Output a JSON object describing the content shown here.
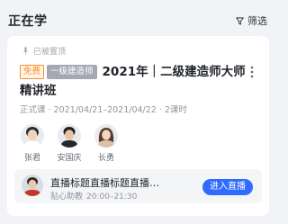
{
  "header": {
    "title": "正在学",
    "filter_label": "筛选"
  },
  "course": {
    "pinned_label": "已被置顶",
    "tags": {
      "free": "免费",
      "category": "一级建造师"
    },
    "title": "2021年｜二级建造师大师精讲班",
    "meta": "正式课 · 2021/04/21–2021/04/22 · 2课时",
    "teachers": [
      {
        "name": "张君"
      },
      {
        "name": "安国庆"
      },
      {
        "name": "长勇"
      }
    ],
    "live": {
      "title": "直播标题直播标题直播标题直播标题",
      "host": "贴心助教",
      "time": "20:00–21:30",
      "button_label": "进入直播"
    }
  },
  "colors": {
    "accent": "#2f6bff",
    "free_tag": "#ff8a1f",
    "category_tag": "#a3a8b3"
  }
}
